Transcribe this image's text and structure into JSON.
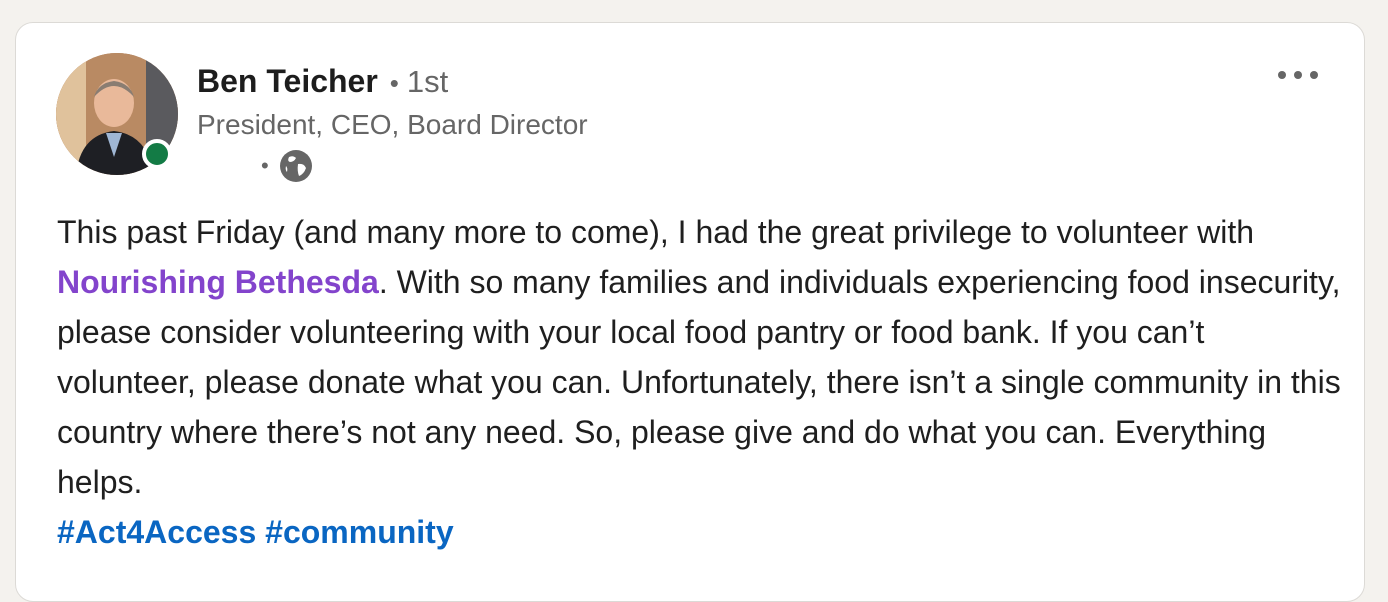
{
  "post": {
    "author": {
      "name": "Ben Teicher",
      "separator": "•",
      "degree": "1st",
      "headline": "President, CEO, Board Director",
      "meta_separator": "•",
      "visibility_icon": "globe-icon",
      "online_status": "online"
    },
    "more_icon": "ellipsis-icon",
    "body": {
      "text_before_mention": "This past Friday (and many more to come), I had the great privilege to volunteer with ",
      "mention": "Nourishing Bethesda",
      "text_after_mention": ". With so many families and individuals experiencing food insecurity, please consider volunteering with your local food pantry or food bank. If you can’t volunteer, please donate what you can. Unfortunately, there isn’t a single community in this country where there’s not any need. So, please give and do what you can. Everything helps.",
      "hashtags": [
        "#Act4Access",
        "#community"
      ]
    }
  },
  "colors": {
    "mention": "#8344cc",
    "hashtag": "#0a66c2",
    "presence": "#137b45",
    "background": "#f4f2ee"
  }
}
